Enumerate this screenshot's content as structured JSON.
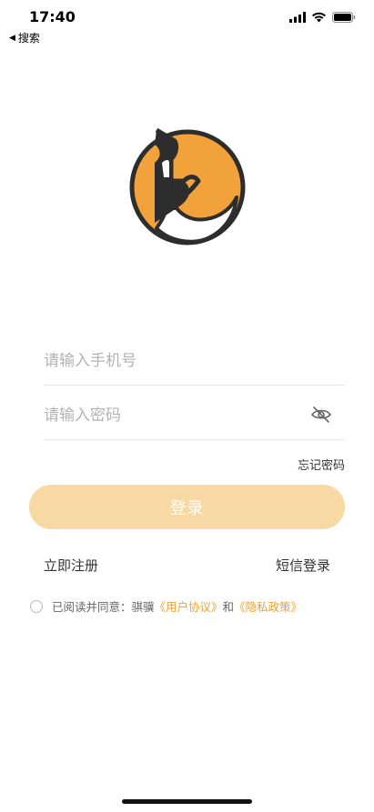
{
  "status_bar": {
    "time": "17:40",
    "back_label": "搜索",
    "icons": [
      "signal-icon",
      "wifi-icon",
      "battery-icon"
    ]
  },
  "logo": {
    "icon": "app-logo-icon",
    "colors": {
      "accent": "#f2a23a",
      "outline": "#2d2d2d"
    }
  },
  "form": {
    "phone_placeholder": "请输入手机号",
    "phone_value": "",
    "password_placeholder": "请输入密码",
    "password_value": "",
    "password_toggle_icon": "eye-off-icon"
  },
  "forgot_password_label": "忘记密码",
  "login_button_label": "登录",
  "register_label": "立即注册",
  "sms_login_label": "短信登录",
  "agreement": {
    "prefix": "已阅读并同意：骐骥",
    "user_agreement": "《用户协议》",
    "conjunction": "和",
    "privacy_policy": "《隐私政策》",
    "checked": false
  },
  "colors": {
    "button_bg": "#f8d9a3",
    "link_orange": "#e8a33a"
  }
}
